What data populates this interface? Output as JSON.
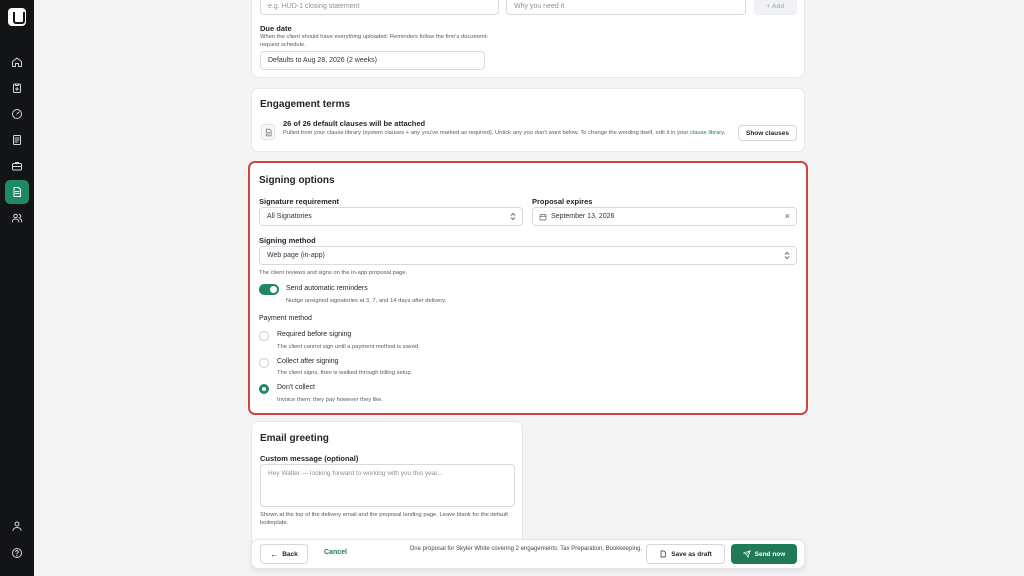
{
  "sidebar": {
    "items": [
      {
        "name": "home",
        "icon": "home-icon"
      },
      {
        "name": "clipboard",
        "icon": "clipboard-icon"
      },
      {
        "name": "dashboard",
        "icon": "gauge-icon"
      },
      {
        "name": "documents",
        "icon": "document-icon"
      },
      {
        "name": "briefcase",
        "icon": "briefcase-icon"
      },
      {
        "name": "proposals",
        "icon": "file-text-icon",
        "active": true
      },
      {
        "name": "clients",
        "icon": "users-icon"
      }
    ],
    "bottom": [
      {
        "name": "account",
        "icon": "user-icon"
      },
      {
        "name": "help",
        "icon": "help-icon"
      }
    ]
  },
  "doc_request": {
    "name_placeholder": "e.g. HUD-1 closing statement",
    "why_placeholder": "Why you need it",
    "add_label": "+ Add",
    "due_date_label": "Due date",
    "due_date_hint": "When the client should have everything uploaded. Reminders follow the firm's document-request schedule.",
    "due_date_placeholder": "Defaults to Aug 28, 2026 (2 weeks)"
  },
  "engagement_terms": {
    "title": "Engagement terms",
    "clauses_count": "26 of 26 default clauses will be attached",
    "clauses_hint": "Pulled from your clause library (system clauses + any you've marked as required). Untick any you don't want below. To change the wording itself, edit it in your",
    "clauses_link": "clause library.",
    "show_clauses": "Show clauses"
  },
  "signing": {
    "title": "Signing options",
    "signature_requirement_label": "Signature requirement",
    "signature_requirement_value": "All Signatories",
    "proposal_expires_label": "Proposal expires",
    "proposal_expires_value": "September 13, 2026",
    "signing_method_label": "Signing method",
    "signing_method_value": "Web page (in-app)",
    "signing_method_hint": "The client reviews and signs on the in-app proposal page.",
    "reminders_label": "Send automatic reminders",
    "reminders_hint": "Nudge unsigned signatories at 3, 7, and 14 days after delivery.",
    "reminders_on": true,
    "payment_method_label": "Payment method",
    "payment_options": [
      {
        "label": "Required before signing",
        "hint": "The client cannot sign until a payment method is saved.",
        "checked": false
      },
      {
        "label": "Collect after signing",
        "hint": "The client signs, then is walked through billing setup.",
        "checked": false
      },
      {
        "label": "Don't collect",
        "hint": "Invoice them; they pay however they like.",
        "checked": true
      }
    ]
  },
  "email_greeting": {
    "title": "Email greeting",
    "custom_message_label": "Custom message (optional)",
    "custom_message_placeholder": "Hey Walter — looking forward to working with you this year...",
    "hint": "Shown at the top of the delivery email and the proposal landing page. Leave blank for the default boilerplate."
  },
  "footer": {
    "back": "Back",
    "cancel": "Cancel",
    "summary": "One proposal for Skyler White covering 2 engagements: Tax Preparation, Bookkeeping.",
    "save_draft": "Save as draft",
    "send_now": "Send now"
  },
  "colors": {
    "accent": "#1f8a61",
    "highlight_border": "#d14343",
    "sidebar_bg": "#131416"
  }
}
